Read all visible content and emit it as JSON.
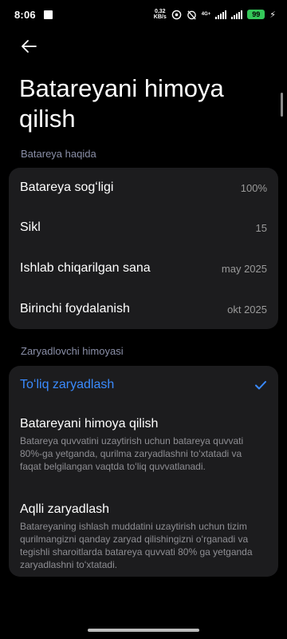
{
  "status_bar": {
    "time": "8:06",
    "net_speed_value": "0,32",
    "net_speed_unit": "KB/s",
    "network_type": "4G+",
    "battery": "99"
  },
  "header": {
    "title": "Batareyani himoya qilish"
  },
  "battery_info": {
    "section_label": "Batareya haqida",
    "rows": [
      {
        "label": "Batareya sogʻligi",
        "value": "100%"
      },
      {
        "label": "Sikl",
        "value": "15"
      },
      {
        "label": "Ishlab chiqarilgan sana",
        "value": "may 2025"
      },
      {
        "label": "Birinchi foydalanish",
        "value": "okt 2025"
      }
    ]
  },
  "charging_protection": {
    "section_label": "Zaryadlovchi himoyasi",
    "options": [
      {
        "title": "Toʻliq zaryadlash",
        "selected": true
      },
      {
        "title": "Batareyani himoya qilish",
        "description": "Batareya quvvatini uzaytirish uchun batareya quvvati 80%-ga yetganda, qurilma zaryadlashni toʻxtatadi va faqat belgilangan vaqtda toʻliq quvvatlanadi."
      },
      {
        "title": "Aqlli zaryadlash",
        "description": "Batareyaning ishlash muddatini uzaytirish uchun tizim qurilmangizni qanday zaryad qilishingizni oʻrganadi va tegishli sharoitlarda batareya quvvati 80% ga yetganda zaryadlashni toʻxtatadi."
      }
    ]
  },
  "colors": {
    "accent": "#3a8bff",
    "background": "#000000",
    "card": "#1c1c1e",
    "battery": "#34c759"
  }
}
